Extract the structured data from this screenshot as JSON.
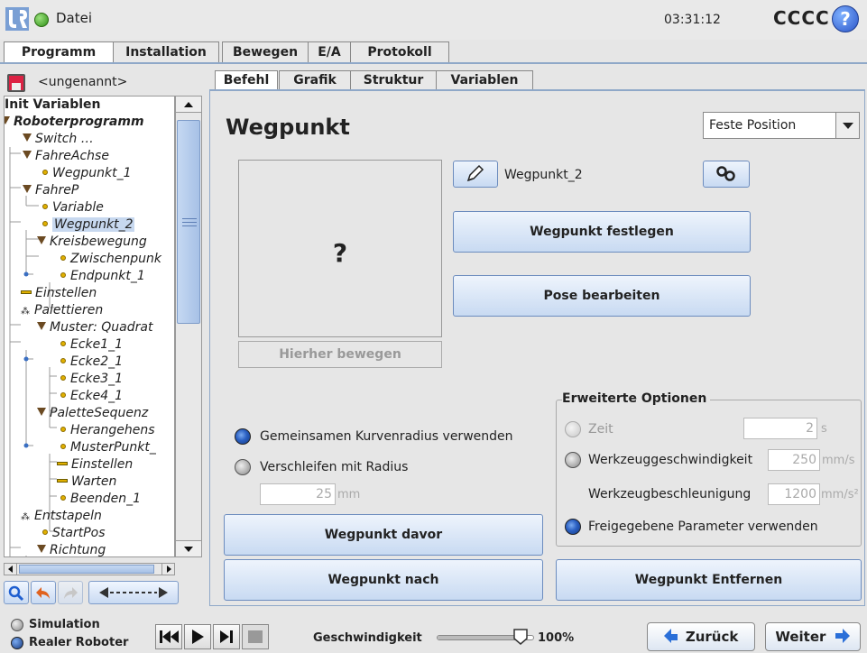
{
  "header": {
    "file_label": "Datei",
    "clock": "03:31:12",
    "robot_name": "CCCC",
    "help": "?"
  },
  "main_tabs": [
    "Programm",
    "Installation",
    "Bewegen",
    "E/A",
    "Protokoll"
  ],
  "program_name": "<ungenannt>",
  "tree": [
    {
      "label": "Init Variablen",
      "style": "bold"
    },
    {
      "label": "Roboterprogramm",
      "style": "bolditalic"
    },
    {
      "label": "Switch …"
    },
    {
      "label": "FahreAchse"
    },
    {
      "label": "Wegpunkt_1"
    },
    {
      "label": "FahreP"
    },
    {
      "label": "Variable"
    },
    {
      "label": "Wegpunkt_2"
    },
    {
      "label": "Kreisbewegung"
    },
    {
      "label": "Zwischenpunk"
    },
    {
      "label": "Endpunkt_1"
    },
    {
      "label": "Einstellen"
    },
    {
      "label": "Palettieren"
    },
    {
      "label": "Muster: Quadrat"
    },
    {
      "label": "Ecke1_1"
    },
    {
      "label": "Ecke2_1"
    },
    {
      "label": "Ecke3_1"
    },
    {
      "label": "Ecke4_1"
    },
    {
      "label": "PaletteSequenz"
    },
    {
      "label": "Herangehens"
    },
    {
      "label": "MusterPunkt_"
    },
    {
      "label": "Einstellen"
    },
    {
      "label": "Warten"
    },
    {
      "label": "Beenden_1"
    },
    {
      "label": "Entstapeln"
    },
    {
      "label": "StartPos"
    },
    {
      "label": "Richtung"
    }
  ],
  "sub_tabs": [
    "Befehl",
    "Grafik",
    "Struktur",
    "Variablen"
  ],
  "page_title": "Wegpunkt",
  "position_select": "Feste Position",
  "preview_placeholder": "?",
  "move_here_button": "Hierher bewegen",
  "waypoint_name": "Wegpunkt_2",
  "set_waypoint_button": "Wegpunkt festlegen",
  "edit_pose_button": "Pose bearbeiten",
  "blend": {
    "shared_radius_label": "Gemeinsamen Kurvenradius verwenden",
    "radius_label": "Verschleifen mit Radius",
    "radius_value": "25",
    "radius_unit": "mm"
  },
  "advanced": {
    "title": "Erweiterte Optionen",
    "time_label": "Zeit",
    "time_value": "2",
    "time_unit": "s",
    "tool_speed_label": "Werkzeuggeschwindigkeit",
    "tool_speed_value": "250",
    "tool_speed_unit": "mm/s",
    "tool_accel_label": "Werkzeugbeschleunigung",
    "tool_accel_value": "1200",
    "tool_accel_unit": "mm/s²",
    "shared_params_label": "Freigegebene Parameter verwenden"
  },
  "buttons": {
    "before": "Wegpunkt davor",
    "after": "Wegpunkt nach",
    "remove": "Wegpunkt Entfernen"
  },
  "footer": {
    "simulation": "Simulation",
    "real_robot": "Realer Roboter",
    "speed_label": "Geschwindigkeit",
    "speed_value": "100%",
    "speed_fraction": 1.0,
    "back": "Zurück",
    "next": "Weiter"
  }
}
